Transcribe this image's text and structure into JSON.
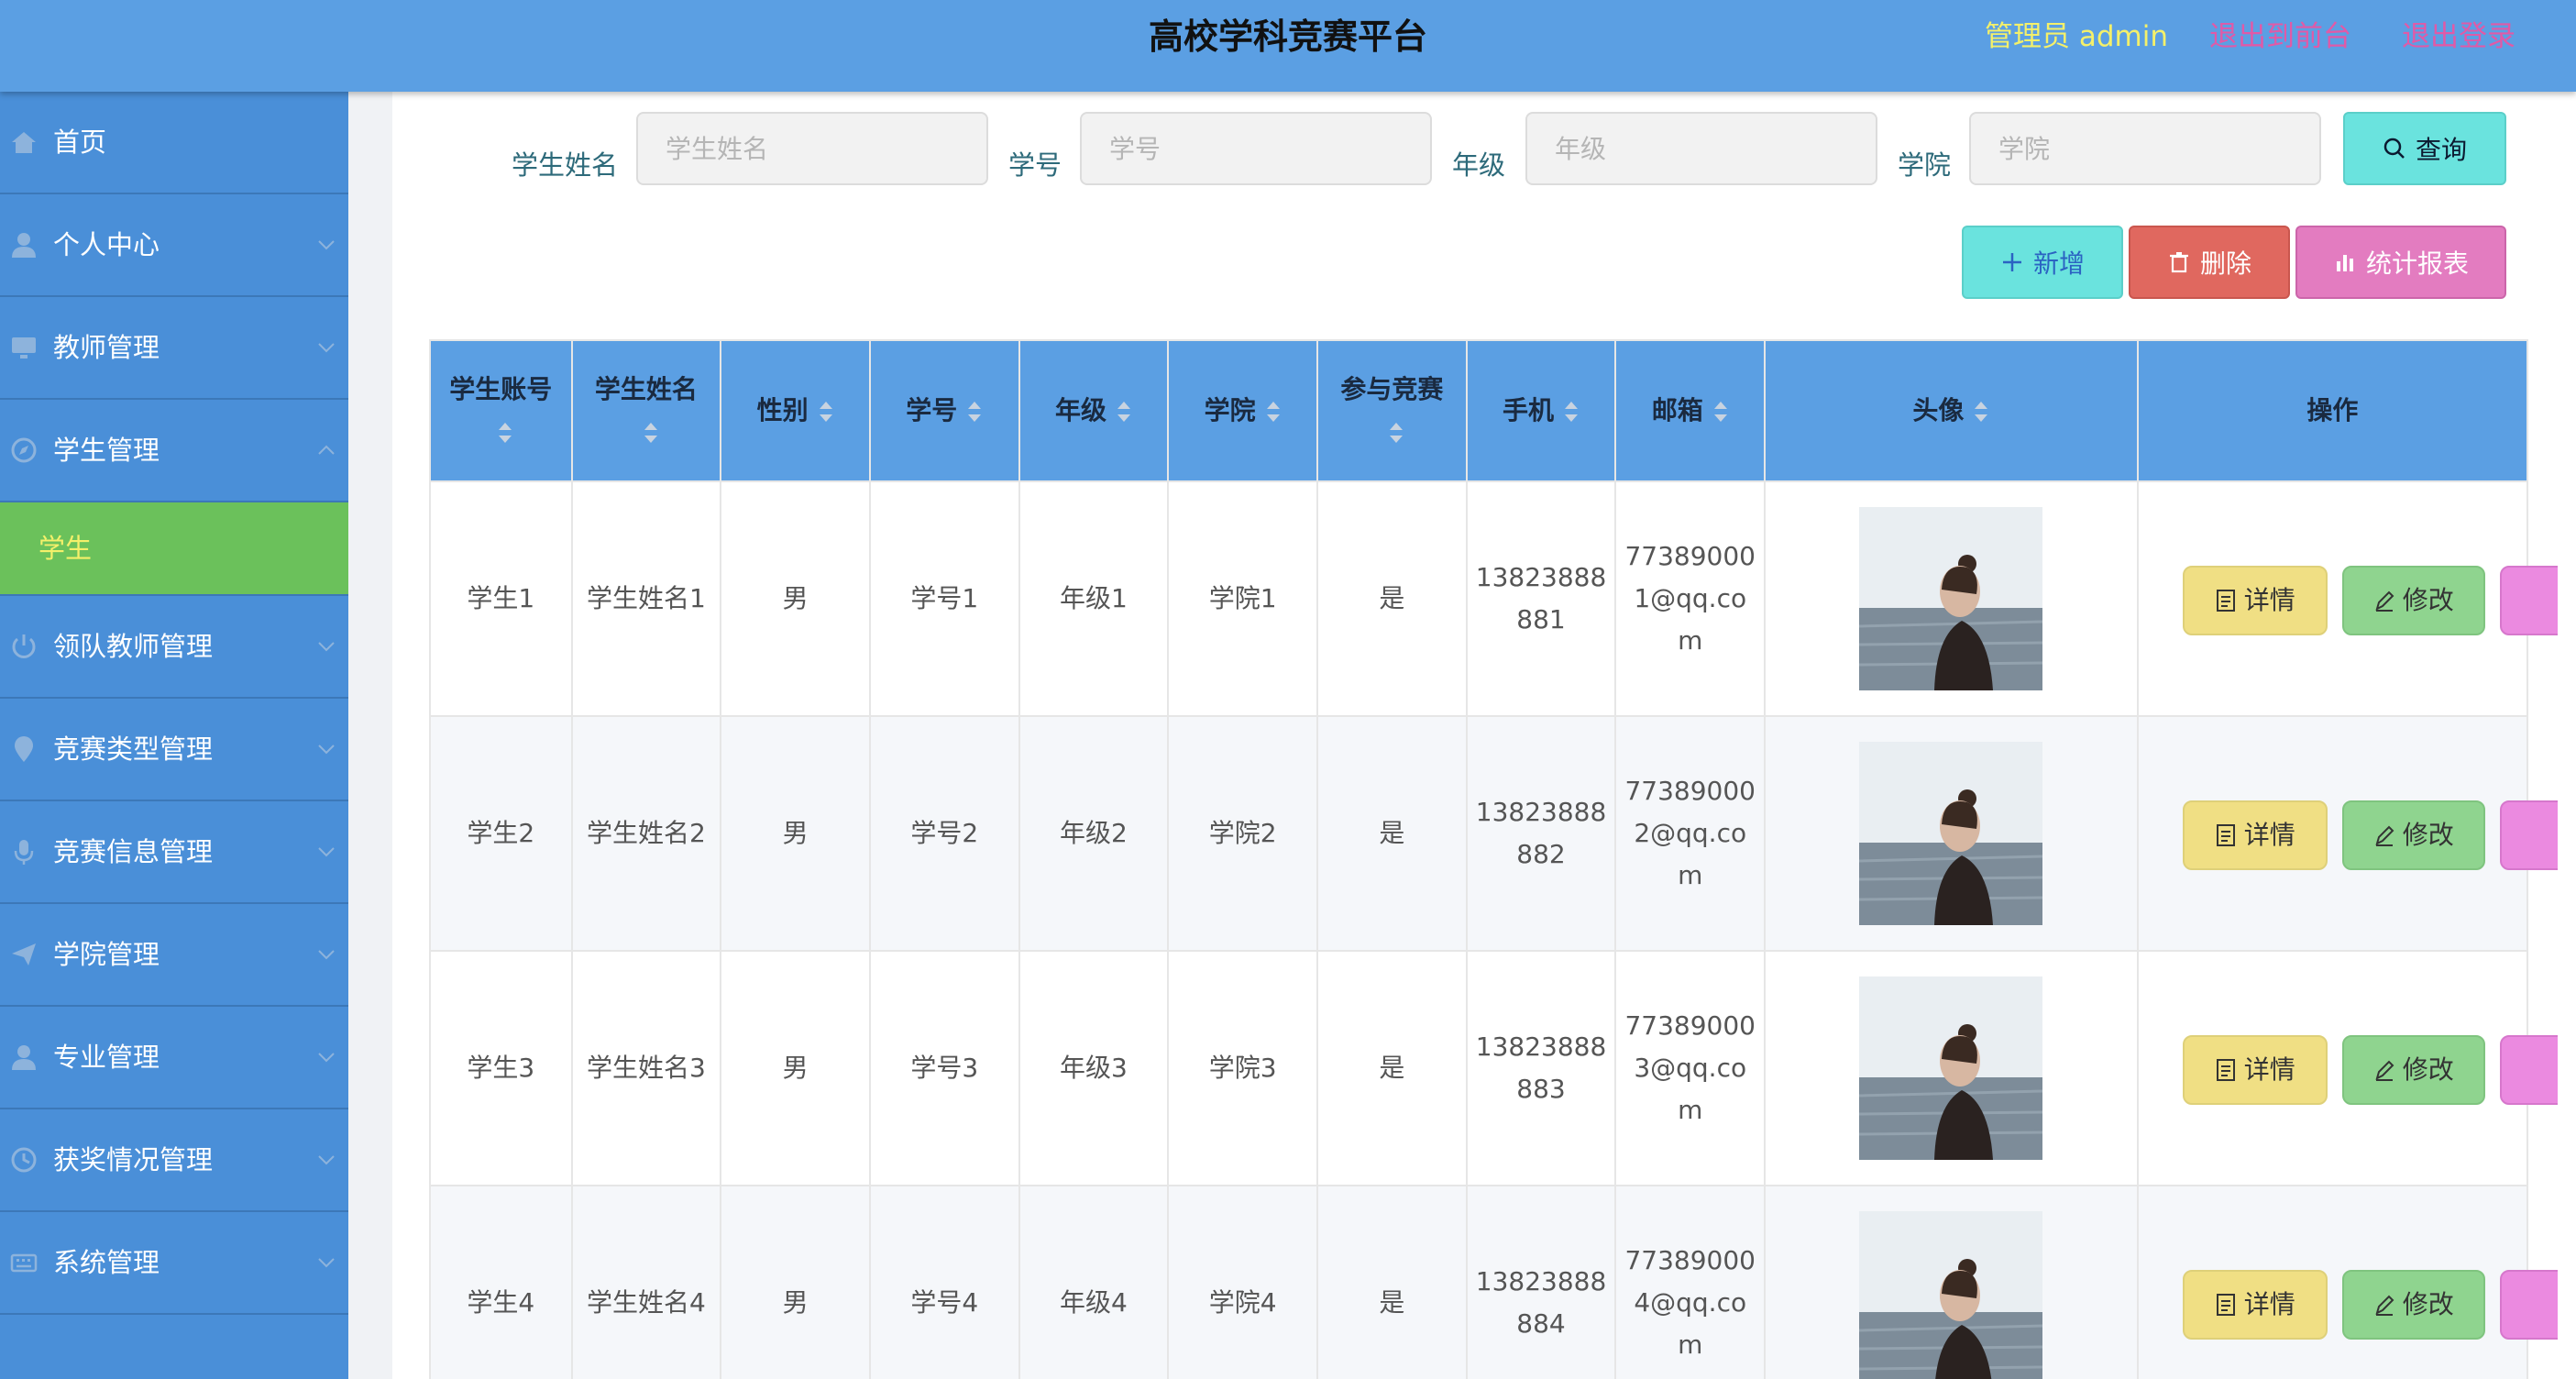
{
  "header": {
    "title": "高校学科竞赛平台",
    "admin": "管理员 admin",
    "back_front": "退出到前台",
    "logout": "退出登录"
  },
  "sidebar": {
    "items": [
      {
        "label": "首页",
        "icon": "home-icon"
      },
      {
        "label": "个人中心",
        "icon": "user-icon"
      },
      {
        "label": "教师管理",
        "icon": "monitor-icon"
      },
      {
        "label": "学生管理",
        "icon": "compass-icon"
      },
      {
        "label": "学生",
        "icon": ""
      },
      {
        "label": "领队教师管理",
        "icon": "power-icon"
      },
      {
        "label": "竞赛类型管理",
        "icon": "location-icon"
      },
      {
        "label": "竞赛信息管理",
        "icon": "microphone-icon"
      },
      {
        "label": "学院管理",
        "icon": "send-icon"
      },
      {
        "label": "专业管理",
        "icon": "user-icon"
      },
      {
        "label": "获奖情况管理",
        "icon": "clock-icon"
      },
      {
        "label": "系统管理",
        "icon": "keyboard-icon"
      }
    ]
  },
  "search": {
    "name_label": "学生姓名",
    "name_placeholder": "学生姓名",
    "no_label": "学号",
    "no_placeholder": "学号",
    "grade_label": "年级",
    "grade_placeholder": "年级",
    "college_label": "学院",
    "college_placeholder": "学院",
    "query": "查询"
  },
  "toolbar": {
    "add": "新增",
    "delete": "删除",
    "report": "统计报表"
  },
  "table": {
    "headers": [
      "学生账号",
      "学生姓名",
      "性别",
      "学号",
      "年级",
      "学院",
      "参与竞赛",
      "手机",
      "邮箱",
      "头像",
      "操作"
    ],
    "rows": [
      {
        "account": "学生1",
        "name": "学生姓名1",
        "gender": "男",
        "no": "学号1",
        "grade": "年级1",
        "college": "学院1",
        "joined": "是",
        "phone": "13823888881",
        "email": "773890001@qq.com"
      },
      {
        "account": "学生2",
        "name": "学生姓名2",
        "gender": "男",
        "no": "学号2",
        "grade": "年级2",
        "college": "学院2",
        "joined": "是",
        "phone": "13823888882",
        "email": "773890002@qq.com"
      },
      {
        "account": "学生3",
        "name": "学生姓名3",
        "gender": "男",
        "no": "学号3",
        "grade": "年级3",
        "college": "学院3",
        "joined": "是",
        "phone": "13823888883",
        "email": "773890003@qq.com"
      },
      {
        "account": "学生4",
        "name": "学生姓名4",
        "gender": "男",
        "no": "学号4",
        "grade": "年级4",
        "college": "学院4",
        "joined": "是",
        "phone": "13823888884",
        "email": "773890004@qq.com"
      }
    ],
    "ops": {
      "detail": "详情",
      "edit": "修改"
    }
  },
  "colors": {
    "header_bg": "#5b9fe3",
    "sidebar_bg": "#4a8fd8",
    "active_bg": "#6bc15b",
    "admin_text": "#f4f06a",
    "link_text": "#e05aa7"
  }
}
